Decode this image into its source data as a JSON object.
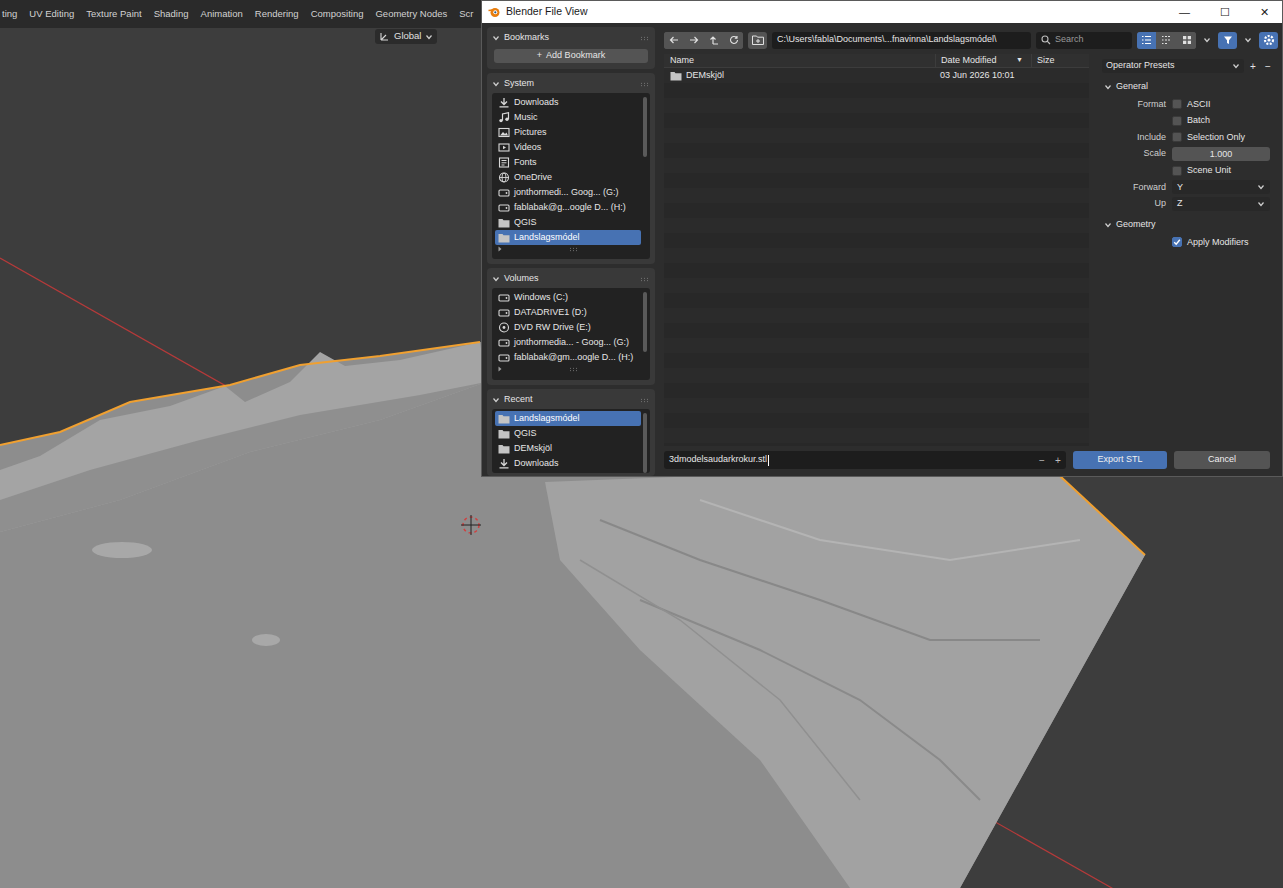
{
  "topbar": {
    "tabs": [
      "ting",
      "UV Editing",
      "Texture Paint",
      "Shading",
      "Animation",
      "Rendering",
      "Compositing",
      "Geometry Nodes",
      "Scr"
    ]
  },
  "viewport_header": {
    "orientation": "Global"
  },
  "dialog": {
    "title": "Blender File View",
    "controls": [
      "—",
      "☐",
      "✕"
    ]
  },
  "sidebar": {
    "bookmarks": {
      "title": "Bookmarks",
      "add_button": {
        "icon": "+",
        "label": "Add Bookmark"
      }
    },
    "system": {
      "title": "System",
      "items": [
        {
          "label": "Downloads",
          "kind": "download",
          "selected": false
        },
        {
          "label": "Music",
          "kind": "music",
          "selected": false
        },
        {
          "label": "Pictures",
          "kind": "picture",
          "selected": false
        },
        {
          "label": "Videos",
          "kind": "video",
          "selected": false
        },
        {
          "label": "Fonts",
          "kind": "font",
          "selected": false
        },
        {
          "label": "OneDrive",
          "kind": "cloud",
          "selected": false
        },
        {
          "label": "jonthormedi... Goog... (G:)",
          "kind": "drive",
          "selected": false
        },
        {
          "label": "fablabak@g...oogle D... (H:)",
          "kind": "drive",
          "selected": false
        },
        {
          "label": "QGIS",
          "kind": "folder",
          "selected": false
        },
        {
          "label": "Landslagsmódel",
          "kind": "folder",
          "selected": true
        }
      ]
    },
    "volumes": {
      "title": "Volumes",
      "items": [
        {
          "label": "Windows (C:)",
          "kind": "drive",
          "selected": false
        },
        {
          "label": "DATADRIVE1 (D:)",
          "kind": "drive",
          "selected": false
        },
        {
          "label": "DVD RW Drive (E:)",
          "kind": "disc",
          "selected": false
        },
        {
          "label": "jonthormedia... - Goog... (G:)",
          "kind": "drive",
          "selected": false
        },
        {
          "label": "fablabak@gm...oogle D... (H:)",
          "kind": "drive",
          "selected": false
        }
      ]
    },
    "recent": {
      "title": "Recent",
      "items": [
        {
          "label": "Landslagsmódel",
          "kind": "folder",
          "selected": true
        },
        {
          "label": "QGIS",
          "kind": "folder",
          "selected": false
        },
        {
          "label": "DEMskjöl",
          "kind": "folder",
          "selected": false
        },
        {
          "label": "Downloads",
          "kind": "download",
          "selected": false
        }
      ]
    }
  },
  "toolbar": {
    "path": "C:\\Users\\fabla\\Documents\\...fnavinna\\Landslagsmódel\\",
    "search": {
      "placeholder": "Search"
    },
    "display_modes": [
      {
        "selected": true
      },
      {
        "selected": false
      },
      {
        "selected": false
      }
    ],
    "filter": {
      "on": true
    },
    "settings": {
      "on": true
    }
  },
  "table": {
    "columns": [
      {
        "label": "Name"
      },
      {
        "label": "Date Modified",
        "sort": "▼"
      },
      {
        "label": "Size"
      }
    ],
    "rows": [
      {
        "name": "DEMskjöl",
        "date": "03 Jun 2026 10:01"
      }
    ]
  },
  "properties": {
    "presets": {
      "label": "Operator Presets",
      "add": "+",
      "remove": "−"
    },
    "sections": [
      {
        "title": "General",
        "expanded": true,
        "rows": [
          {
            "kind": "checkbox",
            "label": "Format",
            "text": "ASCII",
            "checked": false
          },
          {
            "kind": "checkbox",
            "text": "Batch",
            "checked": false
          },
          {
            "kind": "checkbox",
            "label": "Include",
            "text": "Selection Only",
            "checked": false
          },
          {
            "kind": "number",
            "label": "Scale",
            "value": "1.000"
          },
          {
            "kind": "checkbox",
            "text": "Scene Unit",
            "checked": false
          },
          {
            "kind": "select",
            "label": "Forward",
            "value": "Y"
          },
          {
            "kind": "select",
            "label": "Up",
            "value": "Z"
          }
        ]
      },
      {
        "title": "Geometry",
        "expanded": true,
        "rows": [
          {
            "kind": "checkbox",
            "text": "Apply Modifiers",
            "checked": true
          }
        ]
      }
    ]
  },
  "footer": {
    "filename": "3dmodelsaudarkrokur.stl",
    "decrement": "−",
    "increment": "+",
    "export": "Export STL",
    "cancel": "Cancel"
  }
}
